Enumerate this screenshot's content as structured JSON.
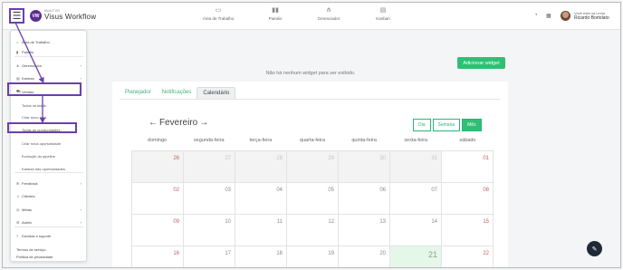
{
  "header": {
    "logo_sup": "BUILT BY",
    "logo_text": "Visus Workflow",
    "logo_letters": "VW",
    "nav": [
      {
        "label": "Área de Trabalho",
        "icon": "monitor-icon"
      },
      {
        "label": "Painéis",
        "icon": "bar-chart-icon"
      },
      {
        "label": "Gerenciador",
        "icon": "hierarchy-icon"
      },
      {
        "label": "Kanban",
        "icon": "kanban-icon"
      }
    ],
    "user_sub": "Você está na Linha",
    "user_name": "Ricardo Bortolato"
  },
  "main": {
    "add_widget": "Adicionar widget",
    "no_widget": "Não há nenhum widget para ser exibido.",
    "tabs": [
      "Planejador",
      "Notificações",
      "Calendário"
    ],
    "month": "Fevereiro",
    "views": [
      "Dia",
      "Semana",
      "Mês"
    ],
    "weekdays": [
      "domingo",
      "segunda-feira",
      "terça-feira",
      "quarta-feira",
      "quinta-feira",
      "sexta-feira",
      "sábado"
    ],
    "days": [
      "26",
      "27",
      "28",
      "29",
      "30",
      "31",
      "01",
      "02",
      "03",
      "04",
      "05",
      "06",
      "07",
      "08",
      "09",
      "10",
      "11",
      "12",
      "13",
      "14",
      "15",
      "16",
      "17",
      "18",
      "19",
      "20",
      "21",
      "22"
    ]
  },
  "sidebar": {
    "items": [
      {
        "label": "Área de Trabalho",
        "icon": "home-icon"
      },
      {
        "label": "Painéis",
        "icon": "bar-chart-icon"
      },
      {
        "label": "Gerenciador",
        "icon": "hierarchy-icon",
        "chev": "›"
      },
      {
        "label": "Kanban",
        "icon": "kanban-icon",
        "chev": "›"
      },
      {
        "label": "Vendas",
        "icon": "cart-icon",
        "chev": "⌄"
      },
      {
        "label": "Todos os leads",
        "sub": true
      },
      {
        "label": "Criar novo lead",
        "sub": true
      },
      {
        "label": "Todas as oportunidades",
        "sub": true
      },
      {
        "label": "Criar nova oportunidade",
        "sub": true
      },
      {
        "label": "Evolução do pipeline",
        "sub": true
      },
      {
        "label": "Kanban das oportunidades",
        "sub": true
      },
      {
        "label": "Feedback",
        "icon": "chat-icon",
        "chev": "›"
      },
      {
        "label": "Clientes",
        "icon": "users-icon"
      },
      {
        "label": "Metas",
        "icon": "target-icon",
        "chev": "›"
      },
      {
        "label": "Admin",
        "icon": "gear-icon",
        "chev": "›"
      },
      {
        "label": "Dúvidas e suporte",
        "icon": "help-icon"
      },
      {
        "label": "Termos de serviço"
      },
      {
        "label": "Política de privacidade"
      }
    ]
  },
  "colors": {
    "accent": "#2fbf74",
    "highlight": "#6a3fb0",
    "brand": "#5b2d91"
  }
}
